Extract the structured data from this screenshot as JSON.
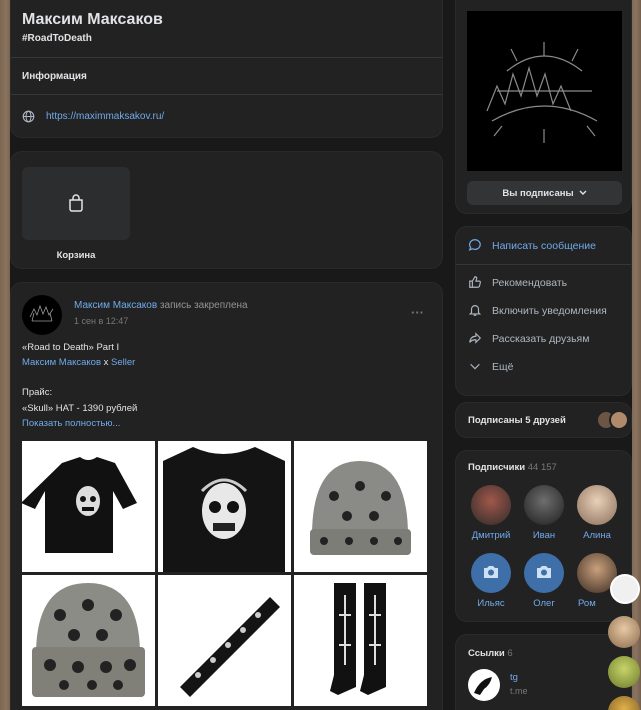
{
  "profile": {
    "name": "Максим Максаков",
    "status": "#RoadToDeath",
    "info_label": "Информация",
    "website": "https://maximmaksakov.ru/"
  },
  "shop": {
    "cart_label": "Корзина"
  },
  "post": {
    "author": "Максим Максаков",
    "action": "запись закреплена",
    "date": "1 сен в 12:47",
    "more": "···",
    "line1": "«Road to Death» Part I",
    "line2_a": "Максим Максаков",
    "line2_x": "x",
    "line2_b": "Seller",
    "price_title": "Прайс:",
    "price_item": "«Skull» HAT - 1390 рублей",
    "show_more": "Показать полностью..."
  },
  "sidebar": {
    "subscribed_button": "Вы подписаны",
    "actions": [
      {
        "label": "Написать сообщение",
        "icon": "message-icon"
      },
      {
        "label": "Рекомендовать",
        "icon": "like-icon"
      },
      {
        "label": "Включить уведомления",
        "icon": "bell-icon"
      },
      {
        "label": "Рассказать друзьям",
        "icon": "share-icon"
      },
      {
        "label": "Ещё",
        "icon": "chevron-down-icon"
      }
    ],
    "friends_label": "Подписаны 5 друзей",
    "subscribers_label": "Подписчики",
    "subscribers_count": "44 157",
    "subscribers": [
      {
        "name": "Дмитрий"
      },
      {
        "name": "Иван"
      },
      {
        "name": "Алина"
      },
      {
        "name": "Ильяс"
      },
      {
        "name": "Олег"
      },
      {
        "name": "Ром"
      }
    ],
    "links_label": "Ссылки",
    "links_count": "6",
    "link": {
      "title": "tg",
      "url": "t.me"
    }
  },
  "colors": {
    "accent": "#71aaeb",
    "card": "#222222",
    "page": "#19191a"
  }
}
